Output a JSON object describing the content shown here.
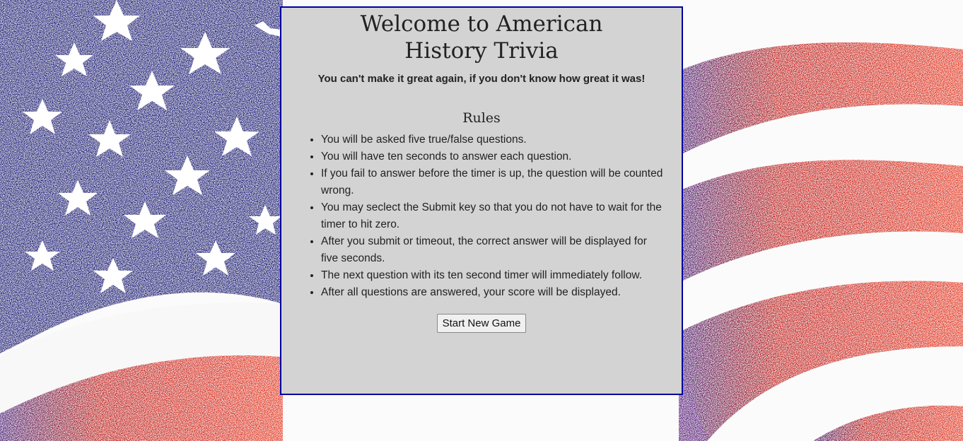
{
  "header": {
    "title": "Welcome to American History Trivia",
    "tagline": "You can't make it great again, if you don't know how great it was!"
  },
  "rules": {
    "heading": "Rules",
    "items": [
      "You will be asked five true/false questions.",
      "You will have ten seconds to answer each question.",
      "If you fail to answer before the timer is up, the question will be counted wrong.",
      "You may seclect the Submit key so that you do not have to wait for the timer to hit zero.",
      "After you submit or timeout, the correct answer will be displayed for five seconds.",
      "The next question with its ten second timer will immediately follow.",
      "After all questions are answered, your score will be displayed."
    ]
  },
  "actions": {
    "start_label": "Start New Game"
  },
  "colors": {
    "panel_bg": "#d3d3d3",
    "panel_border": "#0000a0",
    "flag_blue": "#1a1a7a",
    "flag_red": "#d83010"
  }
}
